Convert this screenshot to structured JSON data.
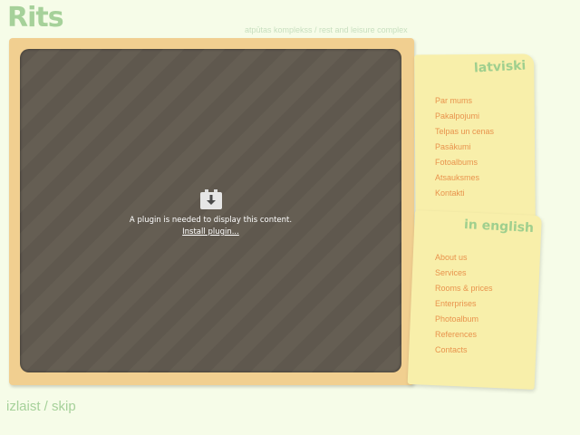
{
  "header": {
    "logo_text": "Rits",
    "tagline": "atpūtas komplekss / rest and leisure complex"
  },
  "plugin": {
    "icon": "plugin-download-icon",
    "message": "A plugin is needed to display this content.",
    "install_link": "Install plugin..."
  },
  "nav_lv": {
    "heading": "latviski",
    "items": [
      "Par mums",
      "Pakalpojumi",
      "Telpas un cenas",
      "Pasākumi",
      "Fotoalbums",
      "Atsauksmes",
      "Kontakti"
    ]
  },
  "nav_en": {
    "heading": "in english",
    "items": [
      "About us",
      "Services",
      "Rooms & prices",
      "Enterprises",
      "Photoalbum",
      "References",
      "Contacts"
    ]
  },
  "footer": {
    "skip_link": "izlaist / skip"
  },
  "colors": {
    "background": "#f6fce8",
    "logo_green": "#a6d19a",
    "menu_orange": "#e8934d",
    "frame_tan": "#f1cf90",
    "paper_yellow": "#f8efaa",
    "plugin_bg": "#5f584e"
  }
}
